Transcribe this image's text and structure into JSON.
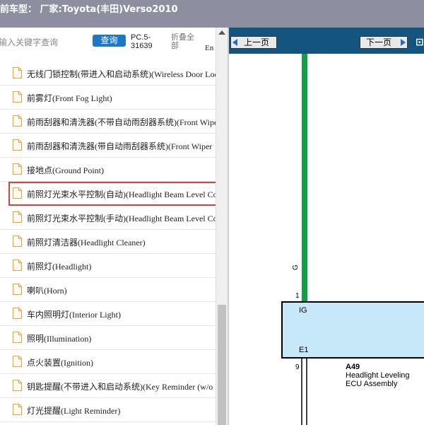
{
  "title_bar": {
    "text": "前车型：  厂家:Toyota(丰田)Verso2010"
  },
  "search": {
    "placeholder": "输入关键字查询",
    "button_label": "查询",
    "pc_label": "PC.5-31639",
    "fold_label": "折叠全部",
    "en_label": "En"
  },
  "tree": {
    "items": [
      {
        "label": "无线门锁控制(带进入和启动系统)(Wireless Door Lock Control"
      },
      {
        "label": "前雾灯(Front Fog Light)"
      },
      {
        "label": "前雨刮器和清洗器(不带自动雨刮器系统)(Front Wiper"
      },
      {
        "label": "前雨刮器和清洗器(带自动雨刮器系统)(Front Wiper"
      },
      {
        "label": "接地点(Ground Point)"
      },
      {
        "label": "前照灯光束水平控制(自动)(Headlight Beam Level Control",
        "selected": true
      },
      {
        "label": "前照灯光束水平控制(手动)(Headlight Beam Level Control"
      },
      {
        "label": "前照灯清洁器(Headlight Cleaner)"
      },
      {
        "label": "前照灯(Headlight)"
      },
      {
        "label": "喇叭(Horn)"
      },
      {
        "label": "车内照明灯(Interior Light)"
      },
      {
        "label": "照明(Illumination)"
      },
      {
        "label": "点火装置(Ignition)"
      },
      {
        "label": "钥匙提醒(不带进入和启动系统)(Key Reminder (w/o Entry"
      },
      {
        "label": "灯光提醒(Light Reminder)"
      }
    ]
  },
  "viewer": {
    "prev_label": "上一页",
    "next_label": "下一页",
    "diagram": {
      "wire_color_label": "G",
      "pin_top": "1",
      "pin_ig": "IG",
      "pin_e1": "E1",
      "pin_bottom": "9",
      "component_code": "A49",
      "component_name_line1": "Headlight Leveling",
      "component_name_line2": "ECU Assembly"
    }
  },
  "colors": {
    "title_bar": "#8d8fa1",
    "nav_bar": "#13557f",
    "search_button": "#1e78c8",
    "selection_outline": "#d9403a",
    "wire_green": "#10a04a",
    "ecu_fill": "#c6e8f8"
  }
}
